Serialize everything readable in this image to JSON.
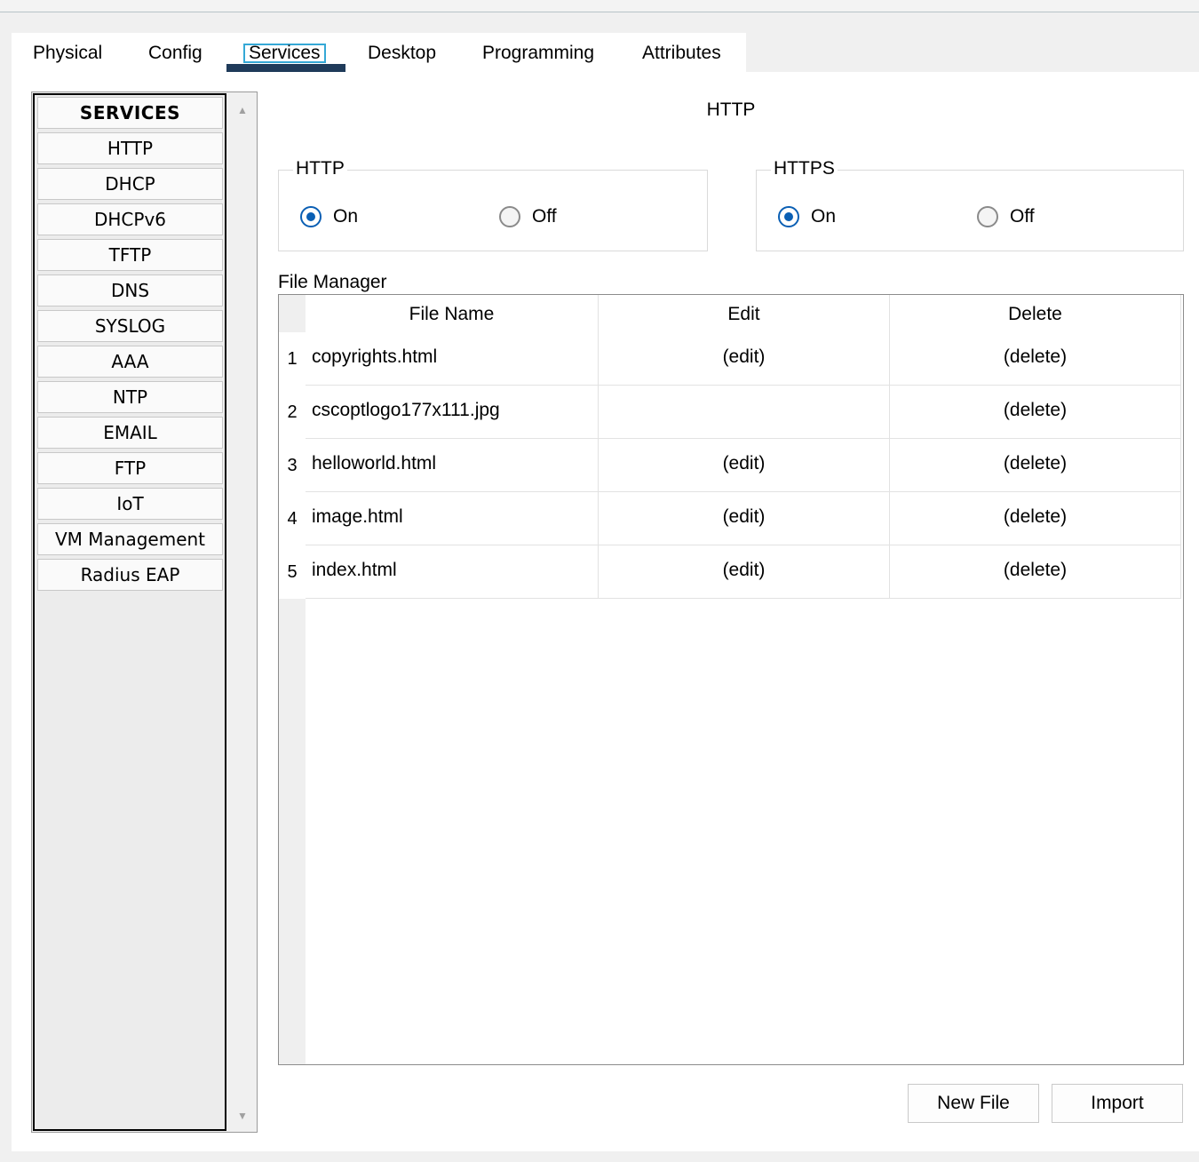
{
  "tabs": [
    {
      "label": "Physical",
      "active": false
    },
    {
      "label": "Config",
      "active": false
    },
    {
      "label": "Services",
      "active": true
    },
    {
      "label": "Desktop",
      "active": false
    },
    {
      "label": "Programming",
      "active": false
    },
    {
      "label": "Attributes",
      "active": false
    }
  ],
  "services": {
    "header": "SERVICES",
    "items": [
      "HTTP",
      "DHCP",
      "DHCPv6",
      "TFTP",
      "DNS",
      "SYSLOG",
      "AAA",
      "NTP",
      "EMAIL",
      "FTP",
      "IoT",
      "VM Management",
      "Radius EAP"
    ]
  },
  "content": {
    "title": "HTTP",
    "http": {
      "legend": "HTTP",
      "on_label": "On",
      "off_label": "Off",
      "selected": "On"
    },
    "https": {
      "legend": "HTTPS",
      "on_label": "On",
      "off_label": "Off",
      "selected": "On"
    }
  },
  "file_manager": {
    "label": "File Manager",
    "columns": [
      "File Name",
      "Edit",
      "Delete"
    ],
    "rows": [
      {
        "num": "1",
        "name": "copyrights.html",
        "edit": "(edit)",
        "delete": "(delete)"
      },
      {
        "num": "2",
        "name": "cscoptlogo177x111.jpg",
        "edit": "",
        "delete": "(delete)"
      },
      {
        "num": "3",
        "name": "helloworld.html",
        "edit": "(edit)",
        "delete": "(delete)"
      },
      {
        "num": "4",
        "name": "image.html",
        "edit": "(edit)",
        "delete": "(delete)"
      },
      {
        "num": "5",
        "name": "index.html",
        "edit": "(edit)",
        "delete": "(delete)"
      }
    ]
  },
  "buttons": {
    "new_file": "New File",
    "import": "Import"
  },
  "icons": {
    "scroll_up": "scroll-up-arrow-icon",
    "scroll_down": "scroll-down-arrow-icon"
  },
  "colors": {
    "accent": "#0a5fb4",
    "tab_underline": "#1f3b5a",
    "tab_focus": "#35a8d6"
  }
}
